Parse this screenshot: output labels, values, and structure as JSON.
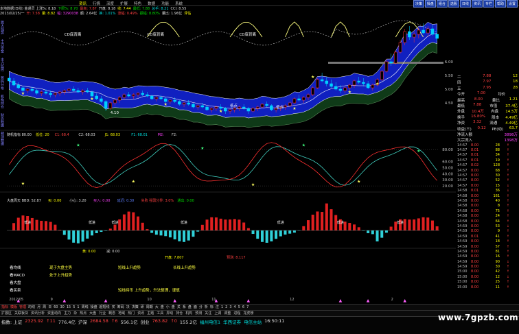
{
  "menu": {
    "items": [
      "资讯",
      "行情",
      "深度",
      "扩展",
      "特色",
      "数据",
      "功能",
      "系统"
    ],
    "active_index": 0,
    "buttons": [
      "决策",
      "操盘",
      "组合",
      "选股",
      "日线",
      "资讯",
      "专栏",
      "帮助",
      "设置"
    ]
  },
  "info": {
    "row1": [
      {
        "t": "本地数据(日线) 金通灵 上涨%: 8.18",
        "c": "c-wht"
      },
      {
        "t": "下限%: 8.70",
        "c": "c-grn"
      },
      {
        "t": "最高: 7.87",
        "c": "c-red"
      },
      {
        "t": "开盘: 8.18",
        "c": "c-wht"
      },
      {
        "t": "收: 7.44",
        "c": "c-yel"
      },
      {
        "t": "最低: 7.88",
        "c": "c-grn"
      },
      {
        "t": "总手: 8.21",
        "c": "c-cy"
      },
      {
        "t": "CCI: 8.55",
        "c": "c-wht"
      }
    ],
    "row2": [
      {
        "t": "2013/02/25/一",
        "c": "c-wht"
      },
      {
        "t": "开: 7.58",
        "c": "c-red"
      },
      {
        "t": "量: 8.82",
        "c": "c-yel"
      },
      {
        "t": "幅: 3290038",
        "c": "c-mag"
      },
      {
        "t": "额: 2.64亿",
        "c": "c-wht"
      },
      {
        "t": "换: 1.01%",
        "c": "c-cy"
      },
      {
        "t": "涨幅: 0.49%",
        "c": "c-red"
      },
      {
        "t": "振幅: 8.80%",
        "c": "c-grn"
      },
      {
        "t": "量比: 1.96亿",
        "c": "c-wht"
      },
      {
        "t": "评估",
        "c": "c-yel"
      }
    ]
  },
  "left_tabs": [
    "跳大强势",
    "主力资金",
    "主力监控",
    "筹码分布",
    "机构持仓",
    "财务数据",
    "预测数据"
  ],
  "main_chart": {
    "ylim": [
      3.5,
      7.5
    ],
    "axis_ticks": [
      {
        "v": 6.0,
        "label": "6.00"
      },
      {
        "v": 5.5,
        "label": "5.50"
      },
      {
        "v": 5.0,
        "label": "5.00"
      },
      {
        "v": 4.5,
        "label": "4.50"
      }
    ],
    "annotations": [
      {
        "text": "CD底背离",
        "i": 12,
        "v": 6.95
      },
      {
        "text": "CD底背离",
        "i": 30,
        "v": 6.95
      },
      {
        "text": "CD底背离",
        "i": 50,
        "v": 6.95
      },
      {
        "text": "低点",
        "i": 48,
        "v": 4.35
      },
      {
        "text": "低点",
        "i": 58,
        "v": 4.3
      },
      {
        "text": "4.10",
        "i": 22,
        "v": 4.1
      }
    ],
    "candles": [
      [
        5.4,
        5.5,
        5.2,
        5.3
      ],
      [
        5.3,
        5.4,
        5.1,
        5.15
      ],
      [
        5.15,
        5.25,
        5.0,
        5.05
      ],
      [
        5.05,
        5.1,
        4.9,
        4.95
      ],
      [
        4.95,
        5.05,
        4.85,
        5.0
      ],
      [
        5.0,
        5.1,
        4.9,
        4.95
      ],
      [
        4.95,
        5.0,
        4.8,
        4.85
      ],
      [
        4.85,
        4.95,
        4.75,
        4.9
      ],
      [
        4.9,
        5.0,
        4.8,
        4.85
      ],
      [
        4.85,
        4.95,
        4.7,
        4.8
      ],
      [
        4.8,
        4.9,
        4.7,
        4.85
      ],
      [
        4.85,
        4.95,
        4.75,
        4.9
      ],
      [
        4.9,
        5.0,
        4.8,
        4.95
      ],
      [
        4.95,
        5.05,
        4.85,
        5.0
      ],
      [
        5.0,
        5.1,
        4.9,
        4.95
      ],
      [
        4.95,
        5.05,
        4.85,
        4.9
      ],
      [
        4.9,
        5.0,
        4.8,
        4.95
      ],
      [
        4.95,
        5.05,
        4.85,
        4.9
      ],
      [
        4.9,
        4.95,
        4.7,
        4.75
      ],
      [
        4.75,
        4.85,
        4.6,
        4.65
      ],
      [
        4.65,
        4.75,
        4.5,
        4.55
      ],
      [
        4.55,
        4.6,
        4.2,
        4.3
      ],
      [
        4.3,
        4.55,
        4.25,
        4.5
      ],
      [
        4.5,
        4.65,
        4.4,
        4.6
      ],
      [
        4.6,
        4.75,
        4.5,
        4.7
      ],
      [
        4.7,
        4.85,
        4.6,
        4.8
      ],
      [
        4.8,
        4.9,
        4.7,
        4.75
      ],
      [
        4.75,
        4.85,
        4.65,
        4.8
      ],
      [
        4.8,
        4.9,
        4.7,
        4.85
      ],
      [
        4.85,
        4.95,
        4.75,
        4.8
      ],
      [
        4.8,
        4.9,
        4.7,
        4.75
      ],
      [
        4.75,
        4.8,
        4.6,
        4.65
      ],
      [
        4.65,
        4.75,
        4.55,
        4.7
      ],
      [
        4.7,
        4.8,
        4.6,
        4.65
      ],
      [
        4.65,
        4.7,
        4.5,
        4.55
      ],
      [
        4.55,
        4.65,
        4.45,
        4.6
      ],
      [
        4.6,
        4.7,
        4.5,
        4.55
      ],
      [
        4.55,
        4.6,
        4.4,
        4.45
      ],
      [
        4.45,
        4.55,
        4.35,
        4.5
      ],
      [
        4.5,
        4.6,
        4.4,
        4.45
      ],
      [
        4.45,
        4.5,
        4.3,
        4.35
      ],
      [
        4.35,
        4.45,
        4.25,
        4.4
      ],
      [
        4.4,
        4.5,
        4.3,
        4.35
      ],
      [
        4.35,
        4.4,
        4.2,
        4.25
      ],
      [
        4.25,
        4.35,
        4.15,
        4.3
      ],
      [
        4.3,
        4.4,
        4.2,
        4.35
      ],
      [
        4.35,
        4.45,
        4.25,
        4.3
      ],
      [
        4.3,
        4.35,
        4.1,
        4.2
      ],
      [
        4.2,
        4.3,
        4.1,
        4.25
      ],
      [
        4.25,
        4.35,
        4.15,
        4.3
      ],
      [
        4.3,
        4.4,
        4.2,
        4.35
      ],
      [
        4.35,
        4.45,
        4.25,
        4.3
      ],
      [
        4.3,
        4.35,
        4.1,
        4.2
      ],
      [
        4.2,
        4.35,
        4.15,
        4.3
      ],
      [
        4.3,
        4.4,
        4.2,
        4.35
      ],
      [
        4.35,
        4.5,
        4.3,
        4.45
      ],
      [
        4.45,
        4.55,
        4.35,
        4.4
      ],
      [
        4.4,
        4.45,
        4.2,
        4.25
      ],
      [
        4.25,
        4.35,
        4.15,
        4.3
      ],
      [
        4.3,
        4.4,
        4.2,
        4.35
      ],
      [
        4.35,
        4.45,
        4.25,
        4.4
      ],
      [
        4.4,
        4.55,
        4.35,
        4.5
      ],
      [
        4.5,
        4.7,
        4.45,
        4.65
      ],
      [
        4.65,
        4.8,
        4.55,
        4.6
      ],
      [
        4.6,
        4.75,
        4.5,
        4.7
      ],
      [
        4.7,
        4.85,
        4.6,
        4.8
      ],
      [
        4.8,
        5.1,
        4.75,
        5.05
      ],
      [
        5.05,
        5.4,
        5.0,
        5.35
      ],
      [
        5.35,
        5.6,
        5.25,
        5.3
      ],
      [
        5.3,
        5.45,
        5.1,
        5.2
      ],
      [
        5.2,
        5.35,
        5.05,
        5.1
      ],
      [
        5.1,
        5.25,
        4.95,
        5.0
      ],
      [
        5.0,
        5.15,
        4.85,
        4.95
      ],
      [
        4.95,
        5.1,
        4.85,
        5.05
      ],
      [
        5.05,
        5.2,
        4.95,
        5.15
      ],
      [
        5.15,
        5.35,
        5.05,
        5.3
      ],
      [
        5.3,
        5.45,
        5.2,
        5.25
      ],
      [
        5.25,
        5.4,
        5.1,
        5.2
      ],
      [
        5.2,
        5.3,
        5.0,
        5.05
      ],
      [
        5.05,
        5.2,
        4.95,
        5.15
      ],
      [
        5.15,
        5.4,
        5.1,
        5.35
      ],
      [
        5.35,
        5.7,
        5.3,
        5.65
      ],
      [
        5.65,
        6.1,
        5.6,
        6.0
      ],
      [
        6.0,
        6.3,
        5.85,
        5.95
      ],
      [
        5.95,
        6.4,
        5.9,
        6.35
      ],
      [
        6.35,
        6.8,
        6.3,
        6.7
      ],
      [
        6.7,
        7.2,
        6.6,
        7.1
      ],
      [
        7.1,
        7.3,
        6.8,
        6.9
      ],
      [
        6.9,
        7.1,
        6.7,
        7.0
      ],
      [
        7.0,
        7.25,
        6.85,
        7.15
      ],
      [
        7.15,
        7.4,
        7.0,
        7.05
      ],
      [
        7.05,
        7.3,
        6.9,
        7.2
      ],
      [
        7.2,
        7.35,
        6.95,
        7.0
      ],
      [
        7.0,
        7.15,
        6.75,
        6.85
      ]
    ]
  },
  "kd_panel": {
    "label_line": [
      {
        "t": "随机指标 80.00",
        "c": "c-wht"
      },
      {
        "t": "低位: 20",
        "c": "c-yel"
      },
      {
        "t": "C1: 68.4",
        "c": "c-red"
      },
      {
        "t": "C2: 68.03",
        "c": "c-wht"
      },
      {
        "t": "J1: 68.03",
        "c": "c-yel"
      },
      {
        "t": "F1: 68.01",
        "c": "c-cy"
      },
      {
        "t": "M2: ",
        "c": "c-mag"
      },
      {
        "t": "F2: ",
        "c": "c-wht"
      }
    ],
    "ylim": [
      10,
      100
    ],
    "axis_ticks": [
      {
        "v": 80.0,
        "label": "80.00"
      },
      {
        "v": 60.0,
        "label": "60.00"
      },
      {
        "v": 50.0,
        "label": "50.00"
      },
      {
        "v": 40.0,
        "label": "40.00"
      },
      {
        "v": 30.0,
        "label": "30.00"
      },
      {
        "v": 20.0,
        "label": "20.00"
      }
    ]
  },
  "money_panel": {
    "label_line": [
      {
        "t": "大盘周天 BBD: 52.87",
        "c": "c-wht"
      },
      {
        "t": "买: 0.00",
        "c": "c-yel"
      },
      {
        "t": "小心: 3.20",
        "c": "c-wht"
      },
      {
        "t": "买入: 0.00",
        "c": "c-mag"
      },
      {
        "t": "延迟: 0.30",
        "c": "c-blu"
      },
      {
        "t": "失败 强弱分界: 3.0%",
        "c": "c-red"
      },
      {
        "t": "通出: 0.00",
        "c": "c-grn"
      }
    ],
    "signal_labels": [
      {
        "text": "低进",
        "i": 5
      },
      {
        "text": "低进",
        "i": 24
      },
      {
        "text": "低进",
        "i": 30
      },
      {
        "text": "低进",
        "i": 50
      },
      {
        "text": "低进",
        "i": 78
      },
      {
        "text": "低进",
        "i": 95
      },
      {
        "text": "低进",
        "i": 112
      }
    ]
  },
  "summary_panel": {
    "label_line": [
      {
        "t": "黄: 0.00",
        "c": "c-yel"
      },
      {
        "t": "减: 0.00",
        "c": "c-wht"
      }
    ],
    "values": [
      {
        "t": "开盘: 7.807",
        "c": "c-yel"
      },
      {
        "t": "预测: 8.117",
        "c": "c-red"
      }
    ],
    "rows": [
      {
        "label": "看均线",
        "cols": [
          "现于大盘主势",
          "短线上升趋势",
          "长线上升趋势"
        ]
      },
      {
        "label": "看MACD",
        "cols": [
          "处于上升趋势",
          "",
          ""
        ]
      },
      {
        "label": "看大盘",
        "cols": [
          "",
          "",
          ""
        ]
      },
      {
        "label": "看买卖",
        "cols": [
          "",
          "短线持币 上升趋势，升法整理，谨慎",
          ""
        ]
      }
    ],
    "trade_labels": [
      {
        "text": "低进",
        "i": 3
      },
      {
        "text": "低进",
        "i": 16
      },
      {
        "text": "低进",
        "i": 28
      },
      {
        "text": "买",
        "i": 48
      },
      {
        "text": "卖",
        "i": 60
      },
      {
        "text": "低进",
        "i": 69
      },
      {
        "text": "卖",
        "i": 95
      },
      {
        "text": "低进",
        "i": 103
      },
      {
        "text": "低进",
        "i": 114
      }
    ]
  },
  "date_axis": [
    {
      "label": "2012/05",
      "i": 0
    },
    {
      "label": "9",
      "i": 12
    },
    {
      "label": "10",
      "i": 40
    },
    {
      "label": "11",
      "i": 58
    },
    {
      "label": "12",
      "i": 80
    },
    {
      "label": "2",
      "i": 110
    }
  ],
  "right_panel": {
    "header": [
      {
        "l": "二",
        "v": "7.88",
        "n": "12"
      },
      {
        "l": "四",
        "v": "7.97",
        "n": "18"
      },
      {
        "l": "五",
        "v": "7.95",
        "n": "28"
      }
    ],
    "quote": [
      {
        "l": "今开",
        "v": "7.00",
        "l2": "均价",
        "v2": ""
      },
      {
        "l": "最高",
        "v": "8.00",
        "l2": "量比",
        "v2": "1.21"
      },
      {
        "l": "最低",
        "v": "7.88",
        "l2": "市值",
        "v2": "37.4亿"
      },
      {
        "l": "外盘",
        "v": "10.4万",
        "l2": "内盘",
        "v2": "14.5万"
      },
      {
        "l": "换手",
        "v": "16.80%",
        "l2": "股本",
        "v2": "4.49亿"
      },
      {
        "l": "净资",
        "v": "3.32",
        "l2": "流通",
        "v2": "4.49亿"
      },
      {
        "l": "收益(三)",
        "v": "0.12",
        "l2": "PE(动)",
        "v2": "63.7"
      }
    ],
    "flow": [
      {
        "l": "净流入额",
        "v": "3898万"
      },
      {
        "l": "大宗流入",
        "v": "1398万"
      }
    ],
    "ticks": [
      [
        "14:57",
        "8.00",
        "28",
        "↑"
      ],
      [
        "14:57",
        "8.01",
        "88",
        "↑"
      ],
      [
        "14:57",
        "8.01",
        "34",
        "↑"
      ],
      [
        "14:57",
        "8.01",
        "19",
        "↑"
      ],
      [
        "14:57",
        "8.02",
        "128",
        "↑"
      ],
      [
        "14:57",
        "8.00",
        "68",
        "↑"
      ],
      [
        "14:57",
        "8.00",
        "30",
        "↑"
      ],
      [
        "14:57",
        "8.00",
        "52",
        "↑"
      ],
      [
        "14:57",
        "8.00",
        "15",
        "↓"
      ],
      [
        "14:58",
        "8.01",
        "36",
        "↓"
      ],
      [
        "14:58",
        "8.00",
        "161",
        "↑"
      ],
      [
        "14:58",
        "8.00",
        "40",
        "↑"
      ],
      [
        "14:58",
        "8.00",
        "8",
        "↑"
      ],
      [
        "14:58",
        "8.00",
        "75",
        "↑"
      ],
      [
        "14:58",
        "8.00",
        "24",
        "↑"
      ],
      [
        "14:58",
        "8.00",
        "64",
        "↑"
      ],
      [
        "14:59",
        "8.00",
        "53",
        "↓"
      ],
      [
        "14:59",
        "8.00",
        "9",
        "↑"
      ],
      [
        "14:59",
        "8.01",
        "41",
        "↑"
      ],
      [
        "14:59",
        "8.00",
        "18",
        "↑"
      ],
      [
        "14:59",
        "8.00",
        "57",
        "↑"
      ],
      [
        "14:59",
        "8.00",
        "81",
        "↑"
      ],
      [
        "14:59",
        "8.00",
        "16",
        "↑"
      ],
      [
        "14:59",
        "8.00",
        "90",
        "↓"
      ],
      [
        "14:59",
        "8.00",
        "30",
        "↑"
      ],
      [
        "15:00",
        "8.00",
        "42",
        "↑"
      ],
      [
        "15:00",
        "8.00",
        "12",
        "↓"
      ],
      [
        "15:00",
        "8.00",
        "25",
        "↑"
      ],
      [
        "15:00",
        "8.00",
        "11",
        "↑"
      ],
      [
        "15:00",
        "8.00",
        "31",
        "↑"
      ],
      [
        "15:00",
        "8.01",
        "26",
        "↑"
      ],
      [
        "15:00",
        "8.00",
        "41",
        "↓"
      ],
      [
        "15:00",
        "8.00",
        "7",
        "↑"
      ],
      [
        "15:00",
        "8.01",
        "3050",
        "↑"
      ]
    ]
  },
  "fn_bar": [
    "指标",
    "模版",
    "管理",
    "均线",
    "月",
    "周",
    "日",
    "60",
    "30",
    "15",
    "5",
    "1",
    "周线",
    "操盘",
    "超短线",
    "买",
    "筹码",
    "决",
    "决策",
    "研",
    "周期",
    "大",
    "盘",
    "小",
    "盘",
    "关",
    "系",
    "盘",
    "面",
    "分",
    "析",
    "标",
    "注",
    "1",
    "2",
    "3",
    "4",
    "5",
    "6",
    "7",
    "8",
    "9",
    "10",
    "11",
    "12",
    "13",
    "14",
    "15"
  ],
  "tab_bar": [
    "扩展区",
    "关联板块",
    "资讯分析",
    "资金动向",
    "主力",
    "杂",
    "热点",
    "大盘",
    "行业",
    "概念",
    "地域",
    "热门",
    "资讯",
    "主题",
    "工具",
    "异动",
    "持仓",
    "机构",
    "预测",
    "关注",
    "上调",
    "调整",
    "进程",
    "龙虎榜"
  ],
  "status": [
    {
      "t": "指数: 上证",
      "c": "c-wht"
    },
    {
      "t": "2325.92",
      "c": "c-red"
    },
    {
      "t": "↑11",
      "c": "c-red"
    },
    {
      "t": "776.4亿",
      "c": "c-wht"
    },
    {
      "t": "沪深",
      "c": "c-wht"
    },
    {
      "t": "2684.58",
      "c": "c-red"
    },
    {
      "t": "↑6",
      "c": "c-red"
    },
    {
      "t": "556.1亿",
      "c": "c-wht"
    },
    {
      "t": "创业",
      "c": "c-wht"
    },
    {
      "t": "763.82",
      "c": "c-red"
    },
    {
      "t": "↑0",
      "c": "c-red"
    },
    {
      "t": "155.2亿",
      "c": "c-wht"
    },
    {
      "t": "福州电信1",
      "c": "c-cy"
    },
    {
      "t": "华西证券",
      "c": "c-cy"
    },
    {
      "t": "电信主站",
      "c": "c-cy"
    },
    {
      "t": "16:50:11",
      "c": "c-wht"
    }
  ],
  "watermark": "www.7gpzb.com",
  "colors": {
    "up": "#ff3030",
    "down": "#00d0ff",
    "band_blue": "#1020c0",
    "band_green": "#0f3a18",
    "kd_k": "#ff3030",
    "kd_d": "#40d0c0",
    "ma_white": "#ffffff",
    "curve_yellow": "#ffff80"
  }
}
